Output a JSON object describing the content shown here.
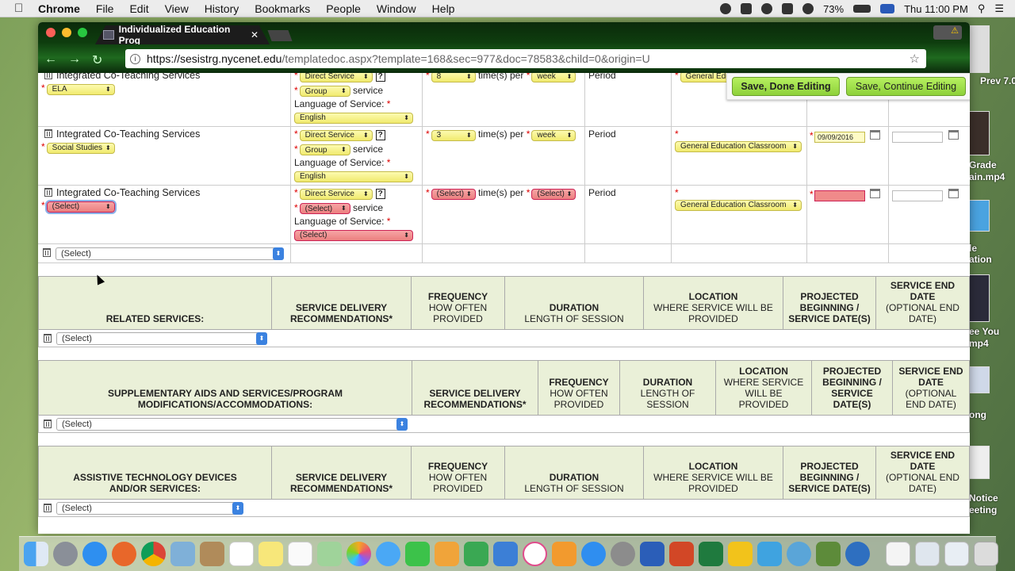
{
  "menubar": {
    "app": "Chrome",
    "items": [
      "File",
      "Edit",
      "View",
      "History",
      "Bookmarks",
      "People",
      "Window",
      "Help"
    ],
    "battery": "73%",
    "clock": "Thu 11:00 PM"
  },
  "browser": {
    "tab_title": "Individualized Education Prog",
    "tab_close": "✕",
    "url_host": "https://sesistrg.nycenet.edu",
    "url_path": "/templatedoc.aspx?template=168&sec=977&doc=78583&child=0&origin=U"
  },
  "save_bar": {
    "done": "Save, Done Editing",
    "continue": "Save, Continue Editing"
  },
  "services": [
    {
      "name": "Integrated Co-Teaching Services",
      "subject": "ELA",
      "delivery": "Direct Service",
      "group": "Group",
      "service_word": "service",
      "lang_label": "Language of Service:",
      "language": "English",
      "freq_num": "8",
      "times_per": "time(s) per",
      "freq_unit": "week",
      "period": "Period",
      "location": "General Edu",
      "begin_date": "",
      "invalid": false
    },
    {
      "name": "Integrated Co-Teaching Services",
      "subject": "Social Studies",
      "delivery": "Direct Service",
      "group": "Group",
      "service_word": "service",
      "lang_label": "Language of Service:",
      "language": "English",
      "freq_num": "3",
      "times_per": "time(s) per",
      "freq_unit": "week",
      "period": "Period",
      "location": "General Education Classroom",
      "begin_date": "09/09/2016",
      "invalid": false
    },
    {
      "name": "Integrated Co-Teaching Services",
      "subject": "(Select)",
      "delivery": "Direct Service",
      "group": "(Select)",
      "service_word": "service",
      "lang_label": "Language of Service:",
      "language": "(Select)",
      "freq_num": "(Select)",
      "times_per": "time(s) per",
      "freq_unit": "(Select)",
      "period": "Period",
      "location": "General Education Classroom",
      "begin_date": "",
      "invalid": true
    }
  ],
  "new_service_select": "(Select)",
  "related": {
    "title": "RELATED SERVICES:",
    "select": "(Select)"
  },
  "supplementary": {
    "title": "SUPPLEMENTARY AIDS AND SERVICES/PROGRAM MODIFICATIONS/ACCOMMODATIONS:",
    "select": "(Select)"
  },
  "assistive": {
    "title": "ASSISTIVE TECHNOLOGY DEVICES AND/OR SERVICES:",
    "select": "(Select)"
  },
  "columns": {
    "delivery": "SERVICE DELIVERY RECOMMENDATIONS*",
    "freq_t": "FREQUENCY",
    "freq_s": "HOW OFTEN PROVIDED",
    "dur_t": "DURATION",
    "dur_s": "LENGTH OF SESSION",
    "loc_t": "LOCATION",
    "loc_s": "WHERE SERVICE WILL BE PROVIDED",
    "proj": "PROJECTED BEGINNING / SERVICE DATE(S)",
    "end_t": "SERVICE END DATE",
    "end_s": "(OPTIONAL END DATE)"
  },
  "desktop_labels": [
    "Prev 7.0",
    "Grade",
    "ain.mp4",
    "le",
    "ation",
    "ee You",
    "mp4",
    "ong",
    "Notice",
    "eeting"
  ],
  "colors": {
    "valid": "#f1ea6e",
    "invalid": "#ec7f7f",
    "header_bg": "#eaf0d8",
    "save_btn": "#8ed13a"
  }
}
